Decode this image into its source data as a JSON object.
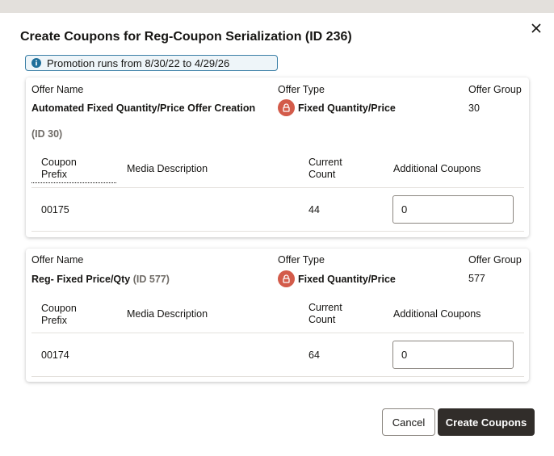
{
  "dialog": {
    "title": "Create Coupons for Reg-Coupon Serialization (ID 236)",
    "info": "Promotion runs from 8/30/22 to 4/29/26"
  },
  "labels": {
    "offer_name": "Offer Name",
    "offer_type": "Offer Type",
    "offer_group": "Offer Group",
    "coupon_prefix_1": "Coupon",
    "coupon_prefix_2": "Prefix",
    "media_description": "Media Description",
    "current_count_1": "Current",
    "current_count_2": "Count",
    "additional_coupons": "Additional Coupons"
  },
  "offers": [
    {
      "name": "Automated Fixed Quantity/Price Offer Creation",
      "id_text": "(ID 30)",
      "type": "Fixed Quantity/Price",
      "group": "30",
      "rows": [
        {
          "prefix": "00175",
          "media_description": "",
          "current_count": "44",
          "additional": "0"
        }
      ]
    },
    {
      "name": "Reg- Fixed Price/Qty",
      "id_text": "(ID 577)",
      "type": "Fixed Quantity/Price",
      "group": "577",
      "rows": [
        {
          "prefix": "00174",
          "media_description": "",
          "current_count": "64",
          "additional": "0"
        }
      ]
    }
  ],
  "buttons": {
    "cancel": "Cancel",
    "create": "Create Coupons"
  },
  "icons": {
    "close": "close-icon",
    "info": "info-icon",
    "lock": "lock-icon"
  },
  "colors": {
    "info_border": "#3a7fa6",
    "lock_badge": "#d35b4a",
    "primary_button": "#312d2a"
  }
}
